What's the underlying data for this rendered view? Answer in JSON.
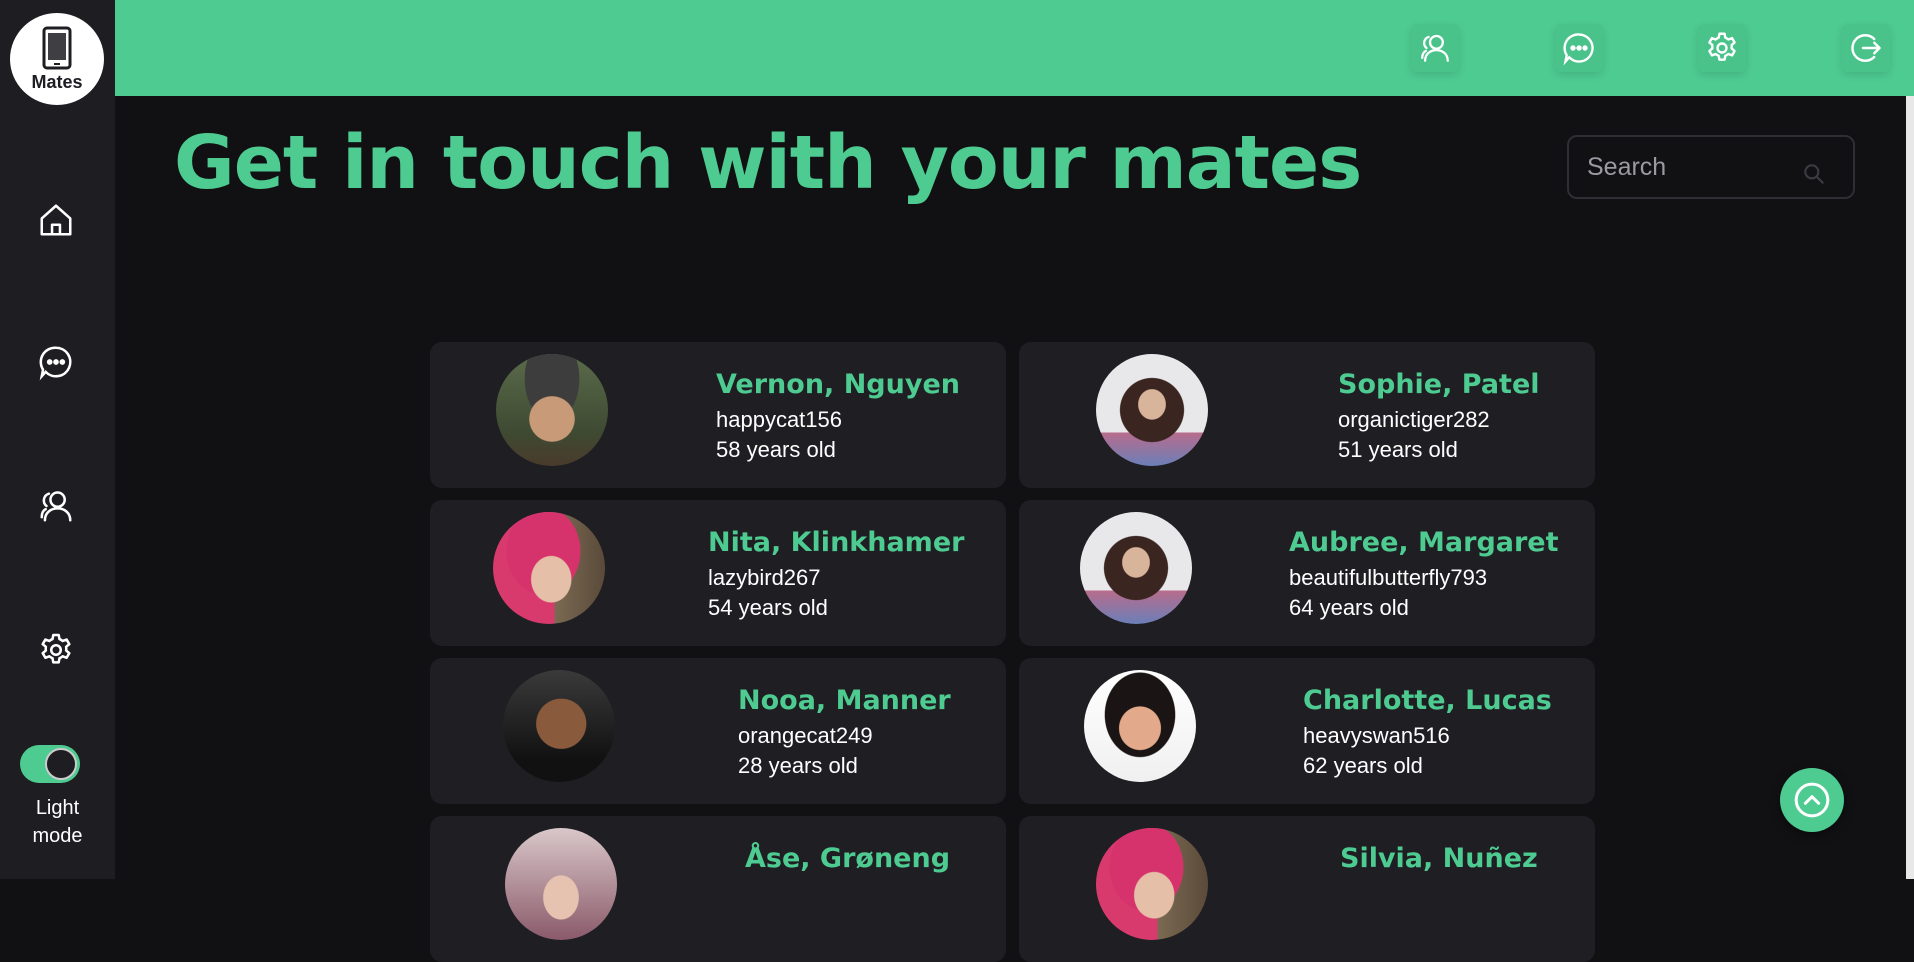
{
  "app": {
    "logo_text": "Mates"
  },
  "sidebar": {
    "items": [
      {
        "icon": "home-icon"
      },
      {
        "icon": "chat-icon"
      },
      {
        "icon": "users-icon"
      },
      {
        "icon": "gear-icon"
      }
    ],
    "theme_toggle": {
      "label": "Light\nmode",
      "on": true
    }
  },
  "topbar": {
    "icons": [
      "users-icon",
      "chat-icon",
      "gear-icon",
      "logout-icon"
    ]
  },
  "main": {
    "title": "Get in touch with your mates",
    "search": {
      "placeholder": "Search"
    }
  },
  "mates": [
    {
      "name": "Vernon, Nguyen",
      "username": "happycat156",
      "age": "58 years old"
    },
    {
      "name": "Sophie, Patel",
      "username": "organictiger282",
      "age": "51 years old"
    },
    {
      "name": "Nita, Klinkhamer",
      "username": "lazybird267",
      "age": "54 years old"
    },
    {
      "name": "Aubree, Margaret",
      "username": "beautifulbutterfly793",
      "age": "64 years old"
    },
    {
      "name": "Nooa, Manner",
      "username": "orangecat249",
      "age": "28 years old"
    },
    {
      "name": "Charlotte, Lucas",
      "username": "heavyswan516",
      "age": "62 years old"
    },
    {
      "name": "Åse, Grøneng",
      "username": "",
      "age": ""
    },
    {
      "name": "Silvia, Nuñez",
      "username": "",
      "age": ""
    }
  ],
  "colors": {
    "accent": "#4ecb91",
    "background": "#111114",
    "sidebar": "#1d1d22",
    "card": "#1e1e23"
  }
}
